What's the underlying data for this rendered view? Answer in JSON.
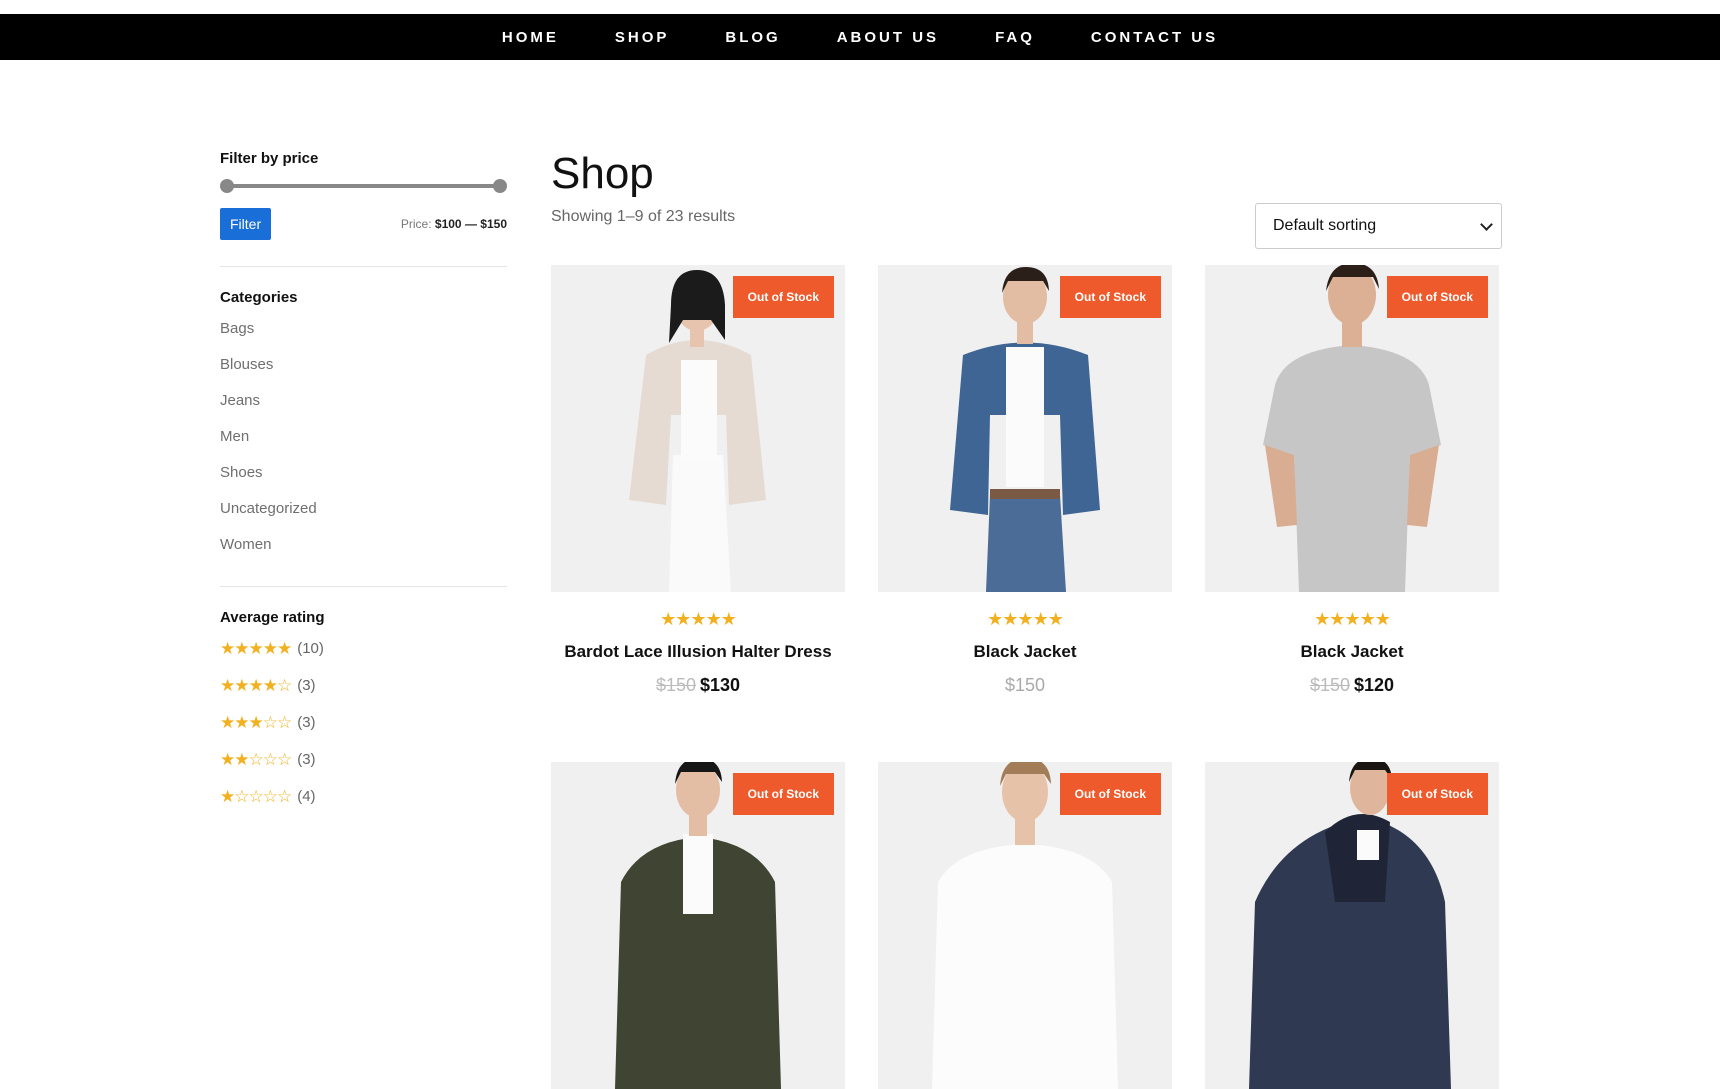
{
  "nav": {
    "items": [
      "HOME",
      "SHOP",
      "BLOG",
      "ABOUT US",
      "FAQ",
      "CONTACT US"
    ]
  },
  "sidebar": {
    "price_filter": {
      "heading": "Filter by price",
      "button_label": "Filter",
      "price_prefix": "Price:",
      "min": "$100",
      "separator": "—",
      "max": "$150"
    },
    "categories": {
      "heading": "Categories",
      "items": [
        "Bags",
        "Blouses",
        "Jeans",
        "Men",
        "Shoes",
        "Uncategorized",
        "Women"
      ]
    },
    "average_rating": {
      "heading": "Average rating",
      "items": [
        {
          "stars": 5,
          "count": "(10)"
        },
        {
          "stars": 4,
          "count": "(3)"
        },
        {
          "stars": 3,
          "count": "(3)"
        },
        {
          "stars": 2,
          "count": "(3)"
        },
        {
          "stars": 1,
          "count": "(4)"
        }
      ]
    }
  },
  "main": {
    "title": "Shop",
    "result_count": "Showing 1–9 of 23 results",
    "sort": {
      "selected": "Default sorting"
    },
    "products": [
      {
        "name": "Bardot Lace Illusion Halter Dress",
        "badge": "Out of Stock",
        "rating": 5,
        "old_price": "$150",
        "price": "$130"
      },
      {
        "name": "Black Jacket",
        "badge": "Out of Stock",
        "rating": 5,
        "old_price": "",
        "price": "$150"
      },
      {
        "name": "Black Jacket",
        "badge": "Out of Stock",
        "rating": 5,
        "old_price": "$150",
        "price": "$120"
      },
      {
        "name": "",
        "badge": "Out of Stock",
        "rating": 0,
        "old_price": "",
        "price": ""
      },
      {
        "name": "",
        "badge": "Out of Stock",
        "rating": 0,
        "old_price": "",
        "price": ""
      },
      {
        "name": "",
        "badge": "Out of Stock",
        "rating": 0,
        "old_price": "",
        "price": ""
      }
    ]
  },
  "colors": {
    "nav_bg": "#000000",
    "badge": "#ee5a2b",
    "star": "#f2b01e",
    "filter_button": "#1a6ed8"
  }
}
